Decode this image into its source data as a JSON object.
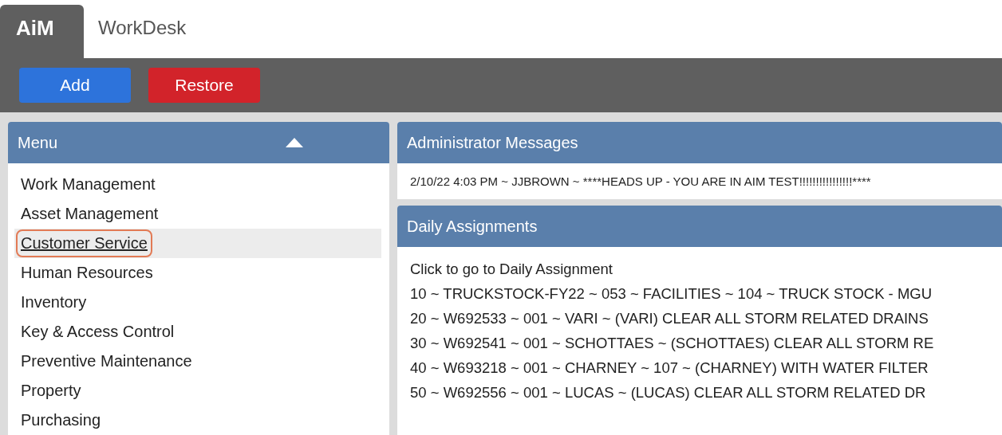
{
  "app": {
    "logo": "AiM",
    "title": "WorkDesk"
  },
  "toolbar": {
    "buttons": [
      {
        "label": "Add",
        "kind": "primary"
      },
      {
        "label": "Restore",
        "kind": "danger"
      }
    ]
  },
  "menu": {
    "title": "Menu",
    "expanded": true,
    "items": [
      {
        "label": "Work Management",
        "selected": false
      },
      {
        "label": "Asset Management",
        "selected": false
      },
      {
        "label": "Customer Service",
        "selected": true
      },
      {
        "label": "Human Resources",
        "selected": false
      },
      {
        "label": "Inventory",
        "selected": false
      },
      {
        "label": "Key & Access Control",
        "selected": false
      },
      {
        "label": "Preventive Maintenance",
        "selected": false
      },
      {
        "label": "Property",
        "selected": false
      },
      {
        "label": "Purchasing",
        "selected": false
      }
    ]
  },
  "admin_messages": {
    "title": "Administrator Messages",
    "messages": [
      "2/10/22 4:03 PM ~ JJBROWN ~ ****HEADS UP - YOU ARE IN AIM TEST!!!!!!!!!!!!!!!!****"
    ]
  },
  "daily_assignments": {
    "title": "Daily Assignments",
    "link": "Click to go to Daily Assignment",
    "rows": [
      "10 ~ TRUCKSTOCK-FY22 ~ 053 ~ FACILITIES ~ 104 ~ TRUCK STOCK - MGU",
      "20 ~ W692533 ~ 001 ~ VARI ~ (VARI) CLEAR ALL STORM RELATED DRAINS",
      "30 ~ W692541 ~ 001 ~ SCHOTTAES ~ (SCHOTTAES) CLEAR ALL STORM RE",
      "40 ~ W693218 ~ 001 ~ CHARNEY ~ 107 ~ (CHARNEY) WITH WATER FILTER",
      "50 ~ W692556 ~ 001 ~ LUCAS ~ (LUCAS) CLEAR ALL STORM RELATED DR"
    ]
  }
}
